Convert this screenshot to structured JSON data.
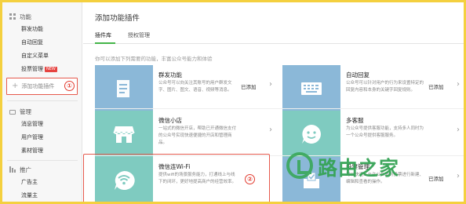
{
  "sidebar": {
    "sections": [
      {
        "title": "功能",
        "icon": "grid-icon",
        "items": [
          "群发功能",
          "自动回复",
          "自定义菜单",
          "投票管理"
        ],
        "badge": "NEW"
      },
      {
        "title": "管理",
        "icon": "monitor-icon",
        "items": [
          "消息管理",
          "用户管理",
          "素材管理"
        ]
      },
      {
        "title": "推广",
        "icon": "promo-icon",
        "items": [
          "广告主",
          "流量主"
        ]
      }
    ],
    "add_plugin_label": "添加功能插件",
    "add_plugin_marker": "①"
  },
  "main": {
    "title": "添加功能插件",
    "tabs": [
      {
        "label": "插件库",
        "active": true
      },
      {
        "label": "授权管理",
        "active": false
      }
    ],
    "hint": "你可以添加下列需要的功能，丰富公众号能力和体验",
    "cards": [
      {
        "title": "群发功能",
        "desc": "公众号可以向关注其账号的用户群发文字、图片、图文、语音、视频等消息。",
        "status": "已添加",
        "icon": "document-icon",
        "color": "#8bb8d8"
      },
      {
        "title": "自动回复",
        "desc": "公众号可以针对用户的行为来设置特定的回复内容和本身的关键字回复规则。",
        "status": "已添加",
        "icon": "keyboard-icon",
        "color": "#8bb8d8"
      },
      {
        "title": "微信小店",
        "desc": "一站式的微信开店，帮助已开通微信支付的公众号实现快速便捷的开店和管理商品。",
        "status": "",
        "icon": "shop-icon",
        "color": "#7fcbc0"
      },
      {
        "title": "多客服",
        "desc": "为公众号提供客服功能，支持多人同时为一个公众号提供客服服务。",
        "status": "",
        "icon": "smile-icon",
        "color": "#7fcbc0"
      },
      {
        "title": "微信连Wi-Fi",
        "desc": "提供wifi的场景服务能力，打通线上与线下的闭环，更好地提高商户的经营效率。",
        "status": "",
        "icon": "wifi-icon",
        "color": "#7fcbc0"
      },
      {
        "title": "投票管理",
        "desc": "可以快速五允许公众号对投票进行新建、编辑和查看的操作。",
        "status": "已添加",
        "icon": "vote-icon",
        "color": "#8bb8d8"
      }
    ],
    "wifi_marker": "②"
  },
  "watermark": {
    "text": "路由之家",
    "color": "#35a355"
  }
}
